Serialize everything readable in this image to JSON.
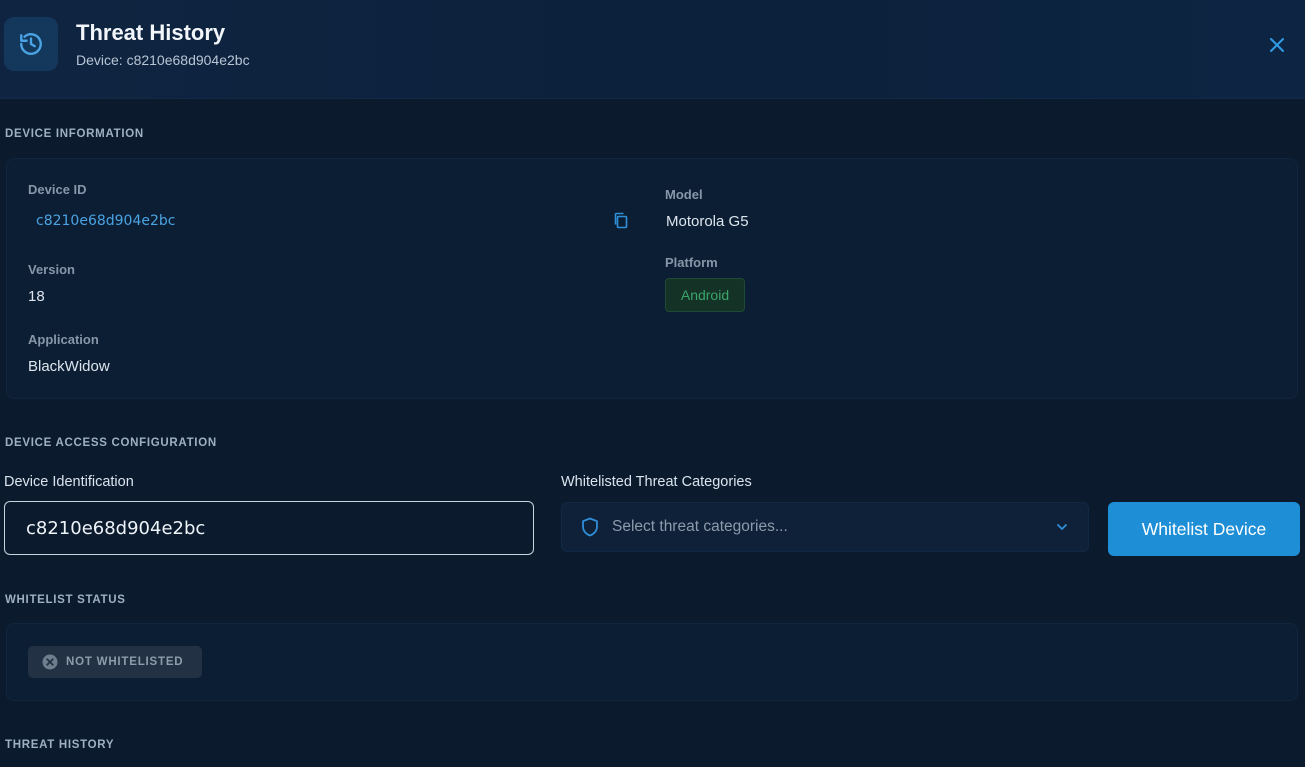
{
  "header": {
    "title": "Threat History",
    "subtitle": "Device: c8210e68d904e2bc",
    "icon": "history-icon",
    "close_icon": "close-icon"
  },
  "device_information": {
    "section_title": "DEVICE INFORMATION",
    "device_id_label": "Device ID",
    "device_id_value": "c8210e68d904e2bc",
    "version_label": "Version",
    "version_value": "18",
    "application_label": "Application",
    "application_value": "BlackWidow",
    "model_label": "Model",
    "model_value": "Motorola G5",
    "platform_label": "Platform",
    "platform_value": "Android"
  },
  "access_config": {
    "section_title": "DEVICE ACCESS CONFIGURATION",
    "identification_label": "Device Identification",
    "identification_value": "c8210e68d904e2bc",
    "categories_label": "Whitelisted Threat Categories",
    "categories_placeholder": "Select threat categories...",
    "whitelist_button": "Whitelist Device"
  },
  "whitelist_status": {
    "section_title": "WHITELIST STATUS",
    "status_text": "NOT WHITELISTED"
  },
  "threat_history": {
    "section_title": "THREAT HISTORY"
  },
  "colors": {
    "background": "#0b1a2d",
    "accent": "#1e8fd6",
    "link": "#4aa3e3",
    "android_green": "#3ba56b"
  }
}
